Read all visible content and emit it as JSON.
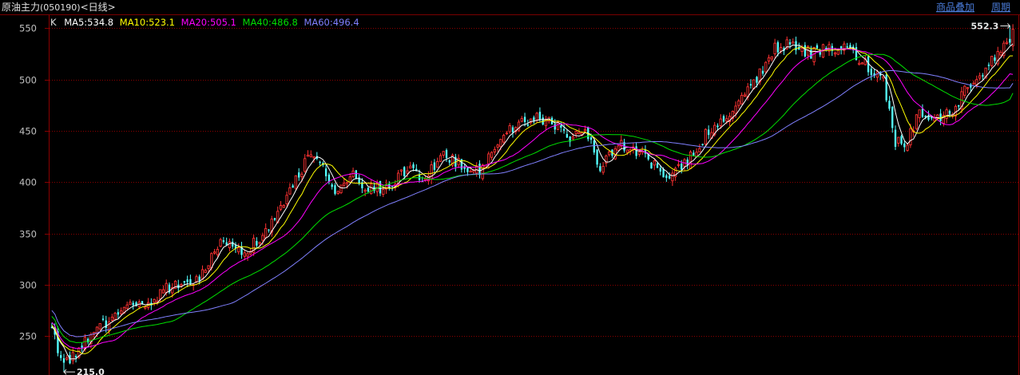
{
  "header": {
    "title": "原油主力",
    "code": "(050190)",
    "period": "<日线>",
    "links": [
      "商品叠加",
      "周期"
    ]
  },
  "legend": {
    "k_label": "K",
    "items": [
      {
        "text": "MA5:534.8",
        "color": "#ffffff"
      },
      {
        "text": "MA10:523.1",
        "color": "#ffff00"
      },
      {
        "text": "MA20:505.1",
        "color": "#ff00ff"
      },
      {
        "text": "MA40:486.8",
        "color": "#00e000"
      },
      {
        "text": "MA60:496.4",
        "color": "#8080ff"
      }
    ]
  },
  "annotations": {
    "high_label": "552.3",
    "low_label": "215.0",
    "high_value": 552.3,
    "low_value": 215.0
  },
  "colors": {
    "up": "#ff3232",
    "down": "#54ffff",
    "grid": "#8b0000",
    "axis_text": "#c0c0c0"
  },
  "chart_data": {
    "type": "candlestick",
    "yticks": [
      250,
      300,
      350,
      400,
      450,
      500,
      550
    ],
    "ylim": [
      212,
      562
    ],
    "grid": true,
    "anchors": [
      {
        "i": 0,
        "v": 255
      },
      {
        "i": 4,
        "v": 222
      },
      {
        "i": 10,
        "v": 240
      },
      {
        "i": 16,
        "v": 258
      },
      {
        "i": 24,
        "v": 280
      },
      {
        "i": 32,
        "v": 282
      },
      {
        "i": 40,
        "v": 300
      },
      {
        "i": 48,
        "v": 305
      },
      {
        "i": 56,
        "v": 340
      },
      {
        "i": 64,
        "v": 330
      },
      {
        "i": 72,
        "v": 355
      },
      {
        "i": 80,
        "v": 400
      },
      {
        "i": 87,
        "v": 430
      },
      {
        "i": 94,
        "v": 390
      },
      {
        "i": 100,
        "v": 408
      },
      {
        "i": 106,
        "v": 392
      },
      {
        "i": 112,
        "v": 398
      },
      {
        "i": 118,
        "v": 412
      },
      {
        "i": 124,
        "v": 405
      },
      {
        "i": 130,
        "v": 425
      },
      {
        "i": 136,
        "v": 418
      },
      {
        "i": 142,
        "v": 410
      },
      {
        "i": 148,
        "v": 440
      },
      {
        "i": 154,
        "v": 455
      },
      {
        "i": 160,
        "v": 462
      },
      {
        "i": 166,
        "v": 458
      },
      {
        "i": 172,
        "v": 445
      },
      {
        "i": 177,
        "v": 452
      },
      {
        "i": 182,
        "v": 415
      },
      {
        "i": 188,
        "v": 440
      },
      {
        "i": 194,
        "v": 430
      },
      {
        "i": 200,
        "v": 415
      },
      {
        "i": 206,
        "v": 405
      },
      {
        "i": 212,
        "v": 425
      },
      {
        "i": 218,
        "v": 450
      },
      {
        "i": 224,
        "v": 462
      },
      {
        "i": 230,
        "v": 485
      },
      {
        "i": 235,
        "v": 505
      },
      {
        "i": 240,
        "v": 530
      },
      {
        "i": 246,
        "v": 535
      },
      {
        "i": 252,
        "v": 525
      },
      {
        "i": 258,
        "v": 530
      },
      {
        "i": 264,
        "v": 530
      },
      {
        "i": 270,
        "v": 515
      },
      {
        "i": 276,
        "v": 500
      },
      {
        "i": 280,
        "v": 440
      },
      {
        "i": 284,
        "v": 440
      },
      {
        "i": 288,
        "v": 470
      },
      {
        "i": 292,
        "v": 460
      },
      {
        "i": 296,
        "v": 465
      },
      {
        "i": 300,
        "v": 472
      },
      {
        "i": 304,
        "v": 495
      },
      {
        "i": 310,
        "v": 510
      },
      {
        "i": 314,
        "v": 525
      },
      {
        "i": 319,
        "v": 545
      }
    ],
    "candle_count": 320,
    "ma_periods": [
      5,
      10,
      20,
      40,
      60
    ],
    "ma_last": [
      534.8,
      523.1,
      505.1,
      486.8,
      496.4
    ]
  }
}
